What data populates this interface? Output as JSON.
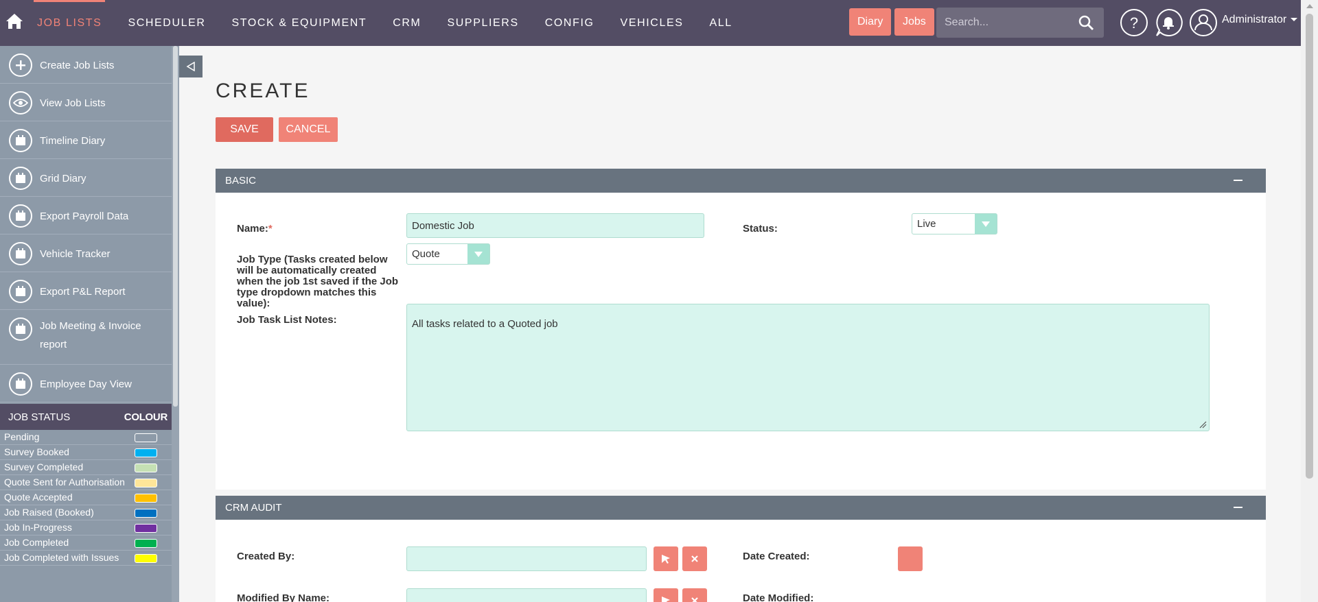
{
  "nav": {
    "items": [
      {
        "label": "JOB LISTS",
        "active": true
      },
      {
        "label": "SCHEDULER"
      },
      {
        "label": "STOCK & EQUIPMENT"
      },
      {
        "label": "CRM"
      },
      {
        "label": "SUPPLIERS"
      },
      {
        "label": "CONFIG"
      },
      {
        "label": "VEHICLES"
      },
      {
        "label": "ALL"
      }
    ],
    "quick_diary": "Diary",
    "quick_jobs": "Jobs",
    "search_placeholder": "Search...",
    "user": "Administrator"
  },
  "sidebar": {
    "actions": [
      {
        "label": "Create Job Lists",
        "icon": "plus-icon"
      },
      {
        "label": "View Job Lists",
        "icon": "eye-icon"
      },
      {
        "label": "Timeline Diary",
        "icon": "calendar-icon"
      },
      {
        "label": "Grid Diary",
        "icon": "calendar-icon"
      },
      {
        "label": "Export Payroll Data",
        "icon": "calendar-icon"
      },
      {
        "label": "Vehicle Tracker",
        "icon": "calendar-icon"
      },
      {
        "label": "Export P&L Report",
        "icon": "calendar-icon"
      },
      {
        "label": "Job Meeting & Invoice report",
        "icon": "calendar-icon"
      },
      {
        "label": "Employee Day View",
        "icon": "calendar-icon"
      }
    ],
    "status_header": {
      "left": "JOB STATUS",
      "right": "COLOUR"
    },
    "statuses": [
      {
        "label": "Pending",
        "color": "#8d9aa8"
      },
      {
        "label": "Survey Booked",
        "color": "#00b0f0"
      },
      {
        "label": "Survey Completed",
        "color": "#c5e0b4"
      },
      {
        "label": "Quote Sent for Authorisation",
        "color": "#ffe699"
      },
      {
        "label": "Quote Accepted",
        "color": "#ffc000"
      },
      {
        "label": "Job Raised (Booked)",
        "color": "#0070c0"
      },
      {
        "label": "Job In-Progress",
        "color": "#7030a0"
      },
      {
        "label": "Job Completed",
        "color": "#00b050"
      },
      {
        "label": "Job Completed with Issues",
        "color": "#ffff00"
      }
    ]
  },
  "page": {
    "title": "CREATE",
    "save_label": "SAVE",
    "cancel_label": "CANCEL"
  },
  "basic": {
    "title": "BASIC",
    "name_label": "Name:",
    "name_required": "*",
    "name_value": "Domestic Job",
    "status_label": "Status:",
    "status_value": "Live",
    "job_type_label": "Job Type (Tasks created below will be automatically created when the job 1st saved if the Job type dropdown matches this value):",
    "job_type_value": "Quote",
    "notes_label": "Job Task List Notes:",
    "notes_value": "All tasks related to a Quoted job"
  },
  "audit": {
    "title": "CRM AUDIT",
    "created_by_label": "Created By:",
    "created_by_value": "",
    "date_created_label": "Date Created:",
    "modified_by_label": "Modified By Name:",
    "modified_by_value": "",
    "date_modified_label": "Date Modified:"
  },
  "colors": {
    "accent": "#f08377",
    "nav_bg": "#534d64",
    "sidebar_bg": "#8d9aa8",
    "panel_head": "#68737f",
    "field_bg": "#d8f5ee"
  }
}
